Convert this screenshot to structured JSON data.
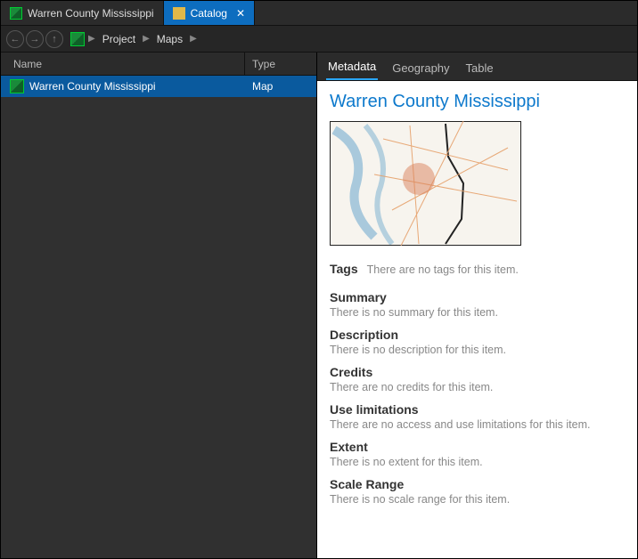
{
  "tabs": [
    {
      "label": "Warren County Mississippi",
      "active": false
    },
    {
      "label": "Catalog",
      "active": true
    }
  ],
  "breadcrumb": [
    "Project",
    "Maps"
  ],
  "list": {
    "columns": {
      "name": "Name",
      "type": "Type"
    },
    "rows": [
      {
        "name": "Warren County Mississippi",
        "type": "Map",
        "selected": true
      }
    ]
  },
  "panel_tabs": [
    {
      "label": "Metadata",
      "active": true
    },
    {
      "label": "Geography",
      "active": false
    },
    {
      "label": "Table",
      "active": false
    }
  ],
  "metadata": {
    "title": "Warren County Mississippi",
    "sections": {
      "tags": {
        "heading": "Tags",
        "value": "There are no tags for this item."
      },
      "summary": {
        "heading": "Summary",
        "value": "There is no summary for this item."
      },
      "description": {
        "heading": "Description",
        "value": "There is no description for this item."
      },
      "credits": {
        "heading": "Credits",
        "value": "There are no credits for this item."
      },
      "use_limitations": {
        "heading": "Use limitations",
        "value": "There are no access and use limitations for this item."
      },
      "extent": {
        "heading": "Extent",
        "value": "There is no extent for this item."
      },
      "scale_range": {
        "heading": "Scale Range",
        "value": "There is no scale range for this item."
      }
    }
  }
}
